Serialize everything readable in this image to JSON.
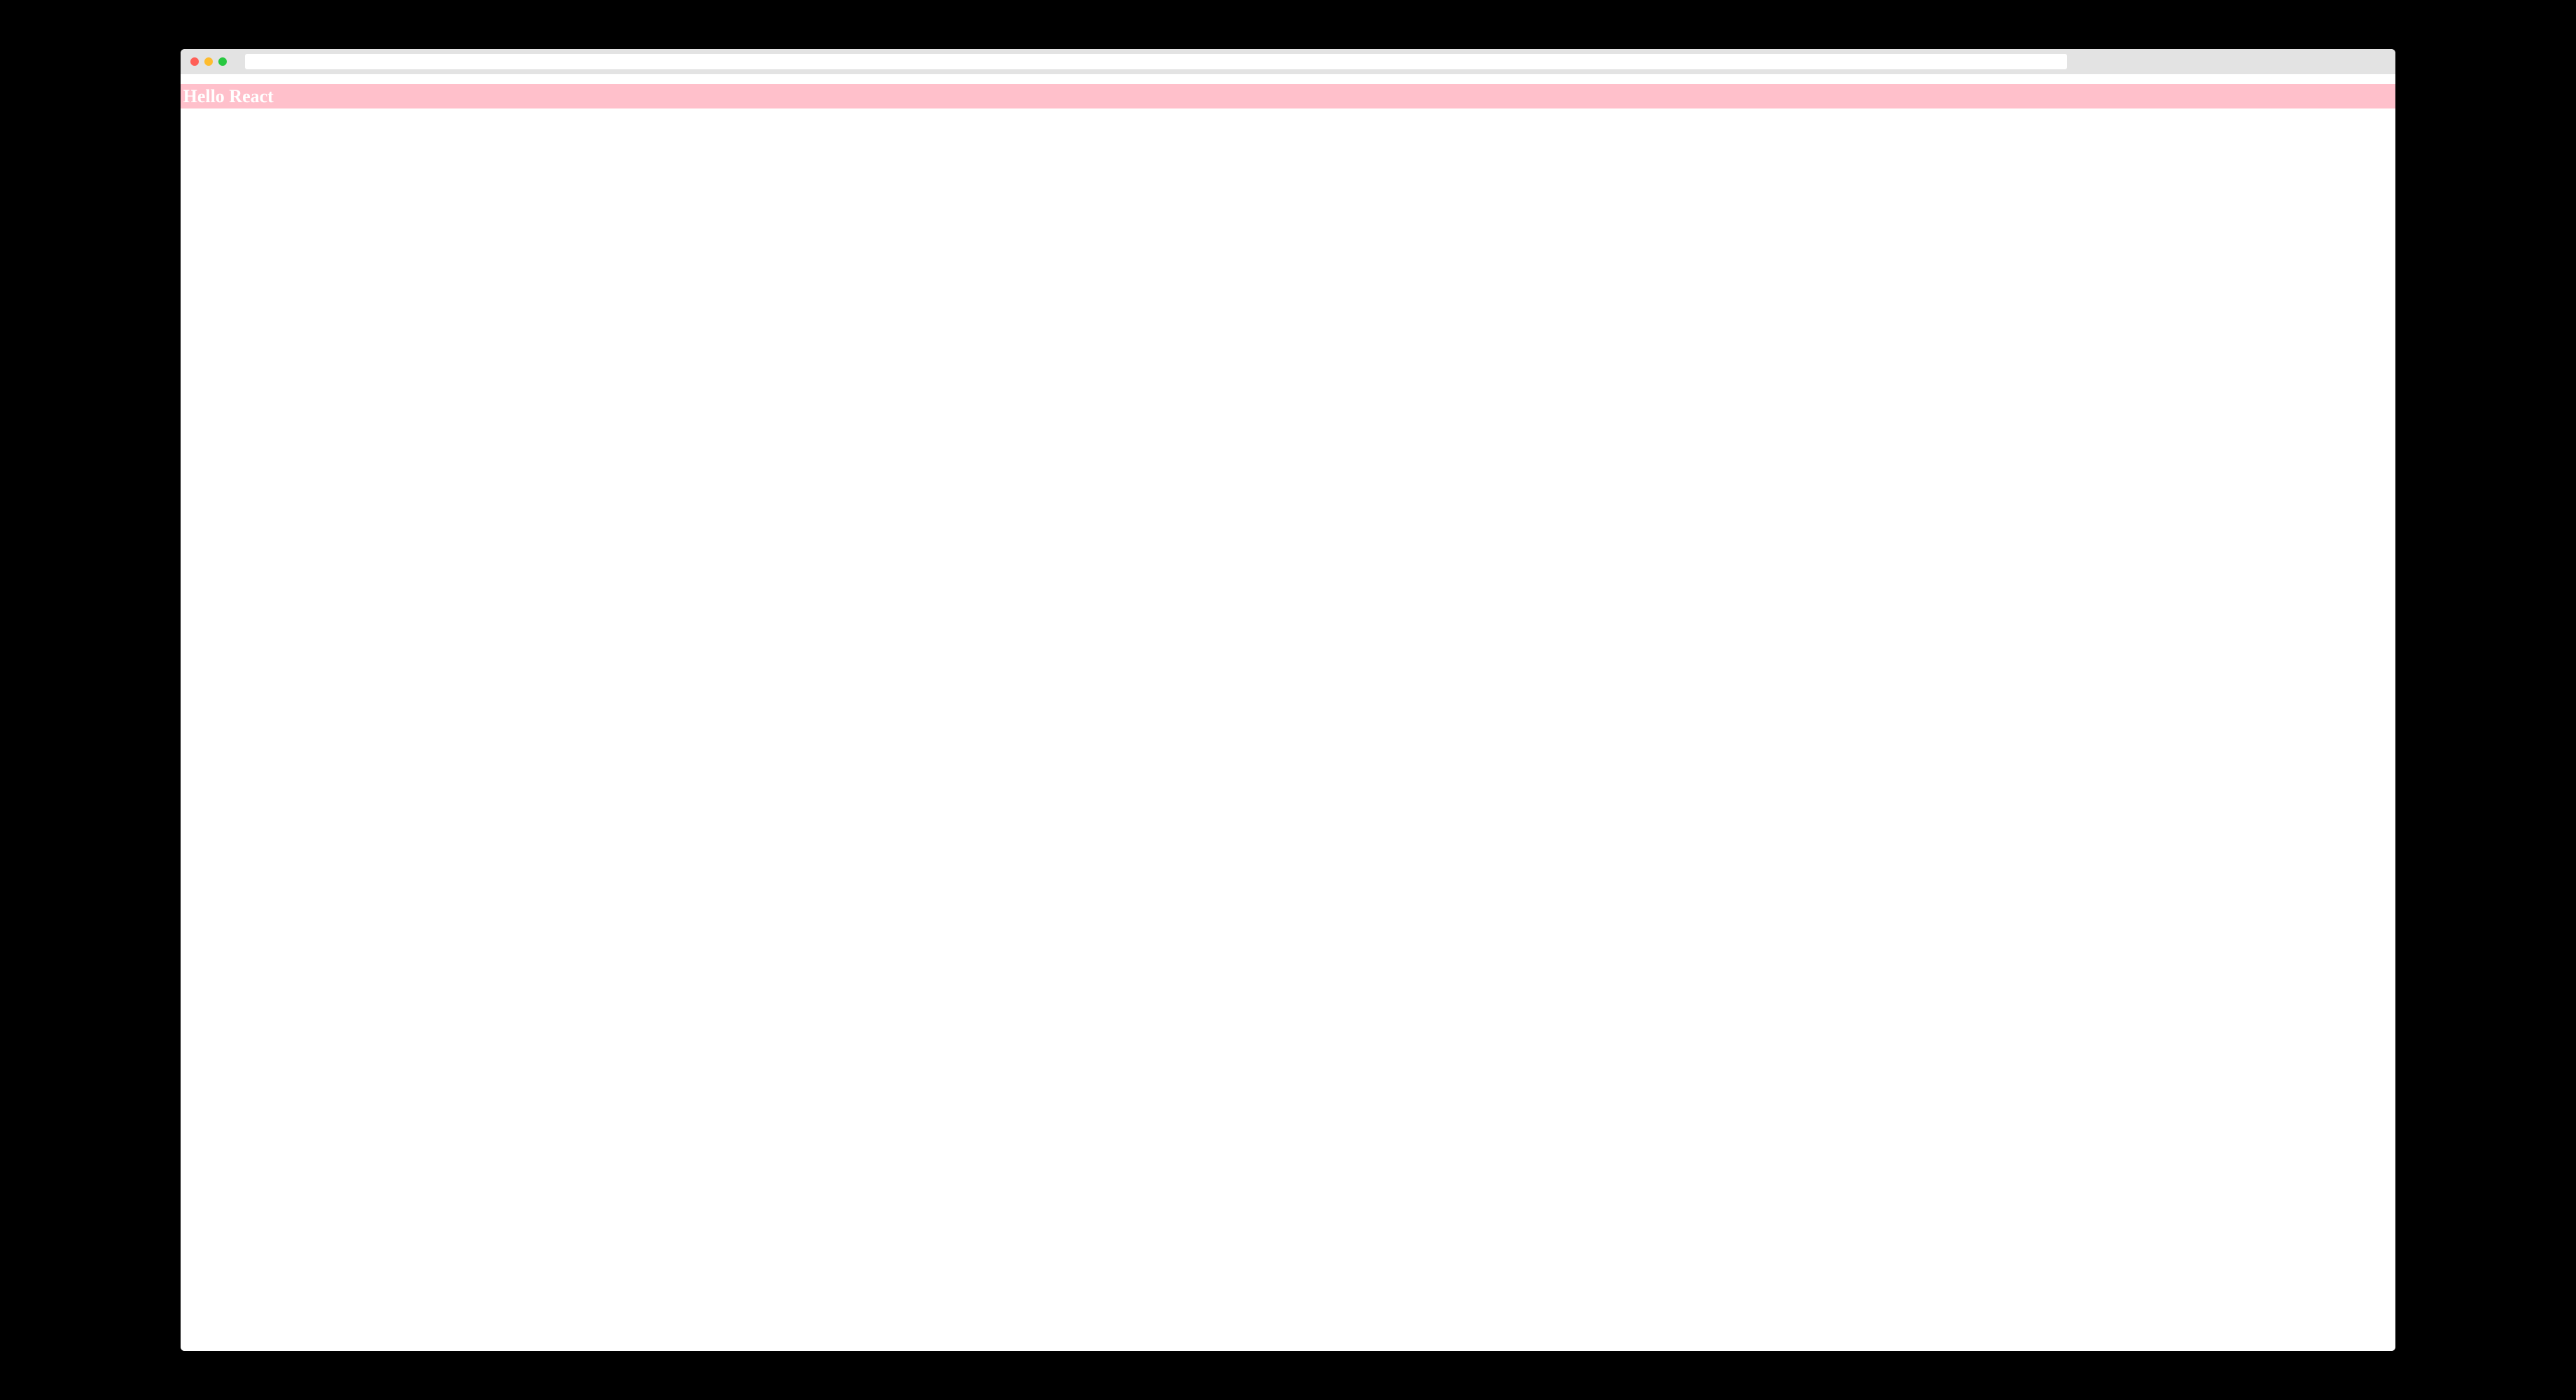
{
  "browser": {
    "address_value": ""
  },
  "page": {
    "heading": "Hello React"
  },
  "colors": {
    "heading_bg": "#ffc0cb",
    "heading_fg": "#ffffff",
    "chrome_bg": "#e3e3e3",
    "page_bg": "#ffffff",
    "outer_bg": "#000000",
    "tl_red": "#ff5f57",
    "tl_yellow": "#febc2e",
    "tl_green": "#28c840"
  }
}
